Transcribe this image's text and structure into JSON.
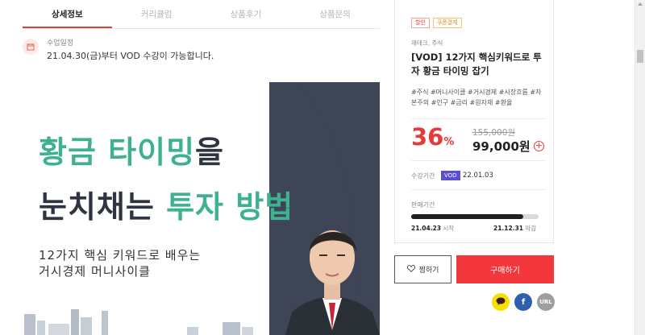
{
  "tabs": [
    {
      "label": "상세정보",
      "active": true
    },
    {
      "label": "커리큘럼",
      "active": false
    },
    {
      "label": "상품후기",
      "active": false
    },
    {
      "label": "상품문의",
      "active": false
    }
  ],
  "notice": {
    "label": "수업일정",
    "text": "21.04.30(금)부터 VOD 수강이 가능합니다."
  },
  "banner": {
    "line1_green": "황금 타이밍",
    "line1_dark": "을",
    "line2_dark": "눈치채는 ",
    "line2_green": "투자 방법",
    "sub1": "12가지 핵심 키워드로 배우는",
    "sub2": "거시경제 머니사이클",
    "colors": {
      "green": "#3db190",
      "dark": "#2f3441",
      "panel": "#3d4556"
    }
  },
  "product": {
    "badges": {
      "sale": "할인",
      "coupon": "쿠폰결제"
    },
    "category": "재테크, 주식",
    "title": "[VOD] 12가지 핵심키워드로 투자 황금 타이밍 잡기",
    "tags": "#주식 #머니사이클 #거시경제 #시장흐름 #자본주의 #인구 #금리 #원자재 #환율",
    "discount_value": "36",
    "discount_unit": "%",
    "original_price": "155,000원",
    "price": "99,000원",
    "period_label": "수강기간",
    "period_badge": "VOD",
    "period_date": "22.01.03",
    "sale_period_label": "판매기간",
    "sale_progress": 0.88,
    "sale_start_date": "21.04.23",
    "sale_start_suffix": "시작",
    "sale_end_date": "21.12.31",
    "sale_end_suffix": "마감",
    "accent": "#f2373d"
  },
  "actions": {
    "wish_label": "찜하기",
    "buy_label": "구매하기",
    "share": {
      "kakao_icon": "kakao-talk-icon",
      "facebook_label": "f",
      "url_label": "URL"
    }
  }
}
